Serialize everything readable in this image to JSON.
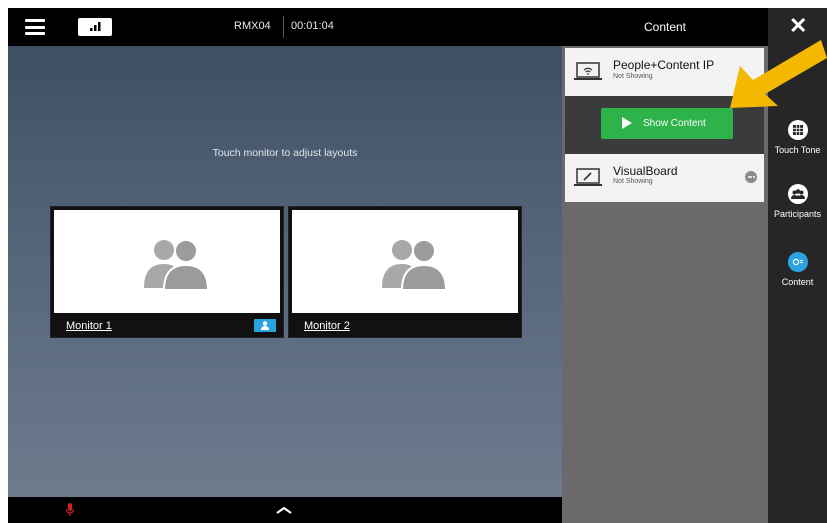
{
  "header": {
    "meeting_name": "RMX04",
    "timer": "00:01:04"
  },
  "stage": {
    "hint": "Touch monitor to adjust layouts",
    "monitors": [
      {
        "label": "Monitor 1",
        "selected": true
      },
      {
        "label": "Monitor 2",
        "selected": false
      }
    ]
  },
  "content_panel": {
    "title": "Content",
    "sources": [
      {
        "name": "People+Content IP",
        "status": "Not Showing",
        "icon": "wireless-laptop-icon"
      },
      {
        "name": "VisualBoard",
        "status": "Not Showing",
        "icon": "whiteboard-icon"
      }
    ],
    "show_button_label": "Show Content"
  },
  "right_nav": {
    "items": [
      {
        "label": "Touch Tone",
        "icon": "keypad-icon"
      },
      {
        "label": "Participants",
        "icon": "participants-icon"
      },
      {
        "label": "Content",
        "icon": "content-icon",
        "active": true
      }
    ]
  },
  "colors": {
    "accent_green": "#2db34a",
    "accent_blue": "#2aa3e0",
    "annotation_arrow": "#f5b800"
  }
}
